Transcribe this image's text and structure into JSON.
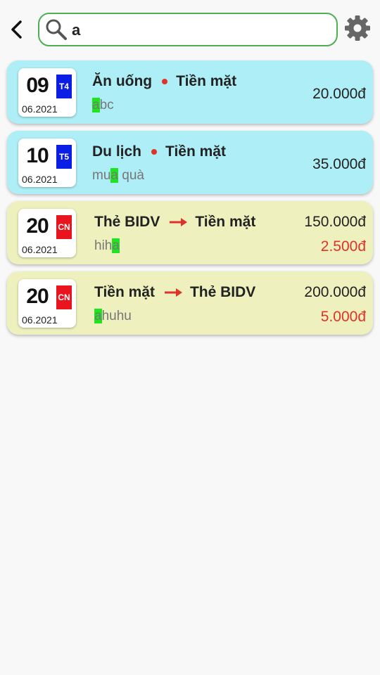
{
  "search": {
    "value": "a"
  },
  "colors": {
    "search_border": "#4caf50",
    "expense_card": "#aeeef6",
    "transfer_card": "#eef1bd",
    "weekday_blue": "#0a1ee6",
    "weekday_red": "#e8151e",
    "highlight": "#1ee61e",
    "fee_red": "#e0322b"
  },
  "icons": {
    "back": "chevron-left-icon",
    "search": "search-icon",
    "settings": "gear-icon"
  },
  "transactions": [
    {
      "day": "09",
      "weekday": "T4",
      "weekday_color": "blue",
      "month_year": "06.2021",
      "category": "Ăn uống",
      "account": "Tiền mặt",
      "note_pre": "",
      "note_match": "a",
      "note_post": "bc",
      "amount": "20.000đ"
    },
    {
      "day": "10",
      "weekday": "T5",
      "weekday_color": "blue",
      "month_year": "06.2021",
      "category": "Du lịch",
      "account": "Tiền mặt",
      "note_pre": "mu",
      "note_match": "a",
      "note_post": " quà",
      "amount": "35.000đ"
    },
    {
      "day": "20",
      "weekday": "CN",
      "weekday_color": "red",
      "month_year": "06.2021",
      "from": "Thẻ BIDV",
      "to": "Tiền mặt",
      "note_pre": "hih",
      "note_match": "a",
      "note_post": "",
      "amount": "150.000đ",
      "fee": "2.500đ"
    },
    {
      "day": "20",
      "weekday": "CN",
      "weekday_color": "red",
      "month_year": "06.2021",
      "from": "Tiền mặt",
      "to": "Thẻ BIDV",
      "note_pre": "",
      "note_match": "a",
      "note_post": "huhu",
      "amount": "200.000đ",
      "fee": "5.000đ"
    }
  ]
}
